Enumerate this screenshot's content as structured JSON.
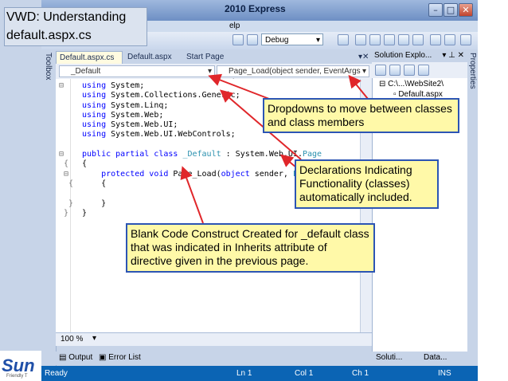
{
  "slide": {
    "title_line1": "VWD: Understanding",
    "title_line2": "default.aspx.cs",
    "logo_text": "Sun",
    "logo_tagline": "Friendly T"
  },
  "window": {
    "title": "2010 Express",
    "menu_fragment": "elp",
    "config": "Debug"
  },
  "toolbox_label": "Toolbox",
  "properties_label": "Properties",
  "tabs": [
    {
      "label": "Default.aspx.cs",
      "close": "✕"
    },
    {
      "label": "Default.aspx"
    },
    {
      "label": "Start Page"
    }
  ],
  "nav": {
    "class_dropdown": "_Default",
    "member_dropdown": "Page_Load(object sender, EventArgs e)"
  },
  "code_lines": [
    "using System;",
    "using System.Collections.Generic;",
    "using System.Linq;",
    "using System.Web;",
    "using System.Web.UI;",
    "using System.Web.UI.WebControls;",
    "",
    "public partial class _Default : System.Web.UI.Page",
    "{",
    "    protected void Page_Load(object sender, EventArgs e)",
    "    {",
    "",
    "    }",
    "}"
  ],
  "zoom": "100 %",
  "bottom_tabs": [
    "Output",
    "Error List"
  ],
  "status": {
    "ready": "Ready",
    "line": "Ln 1",
    "col": "Col 1",
    "ch": "Ch 1",
    "mode": "INS"
  },
  "solution_explorer": {
    "header": "Solution Explo...",
    "root": "C:\\...\\WebSite2\\",
    "item": "Default.aspx",
    "bottom_tab_left": "Soluti...",
    "bottom_tab_right": "Data..."
  },
  "callouts": {
    "dropdowns": "Dropdowns to move between classes and class members",
    "declarations": "Declarations Indicating Functionality (classes) automatically included.",
    "blank": "Blank Code Construct Created for _default class that was indicated in Inherits attribute of directive given in the previous page."
  },
  "colors": {
    "callout_bg": "#fff9a8",
    "callout_border": "#2c55b4",
    "arrow": "#e0262a",
    "statusbar": "#0b64b4"
  }
}
